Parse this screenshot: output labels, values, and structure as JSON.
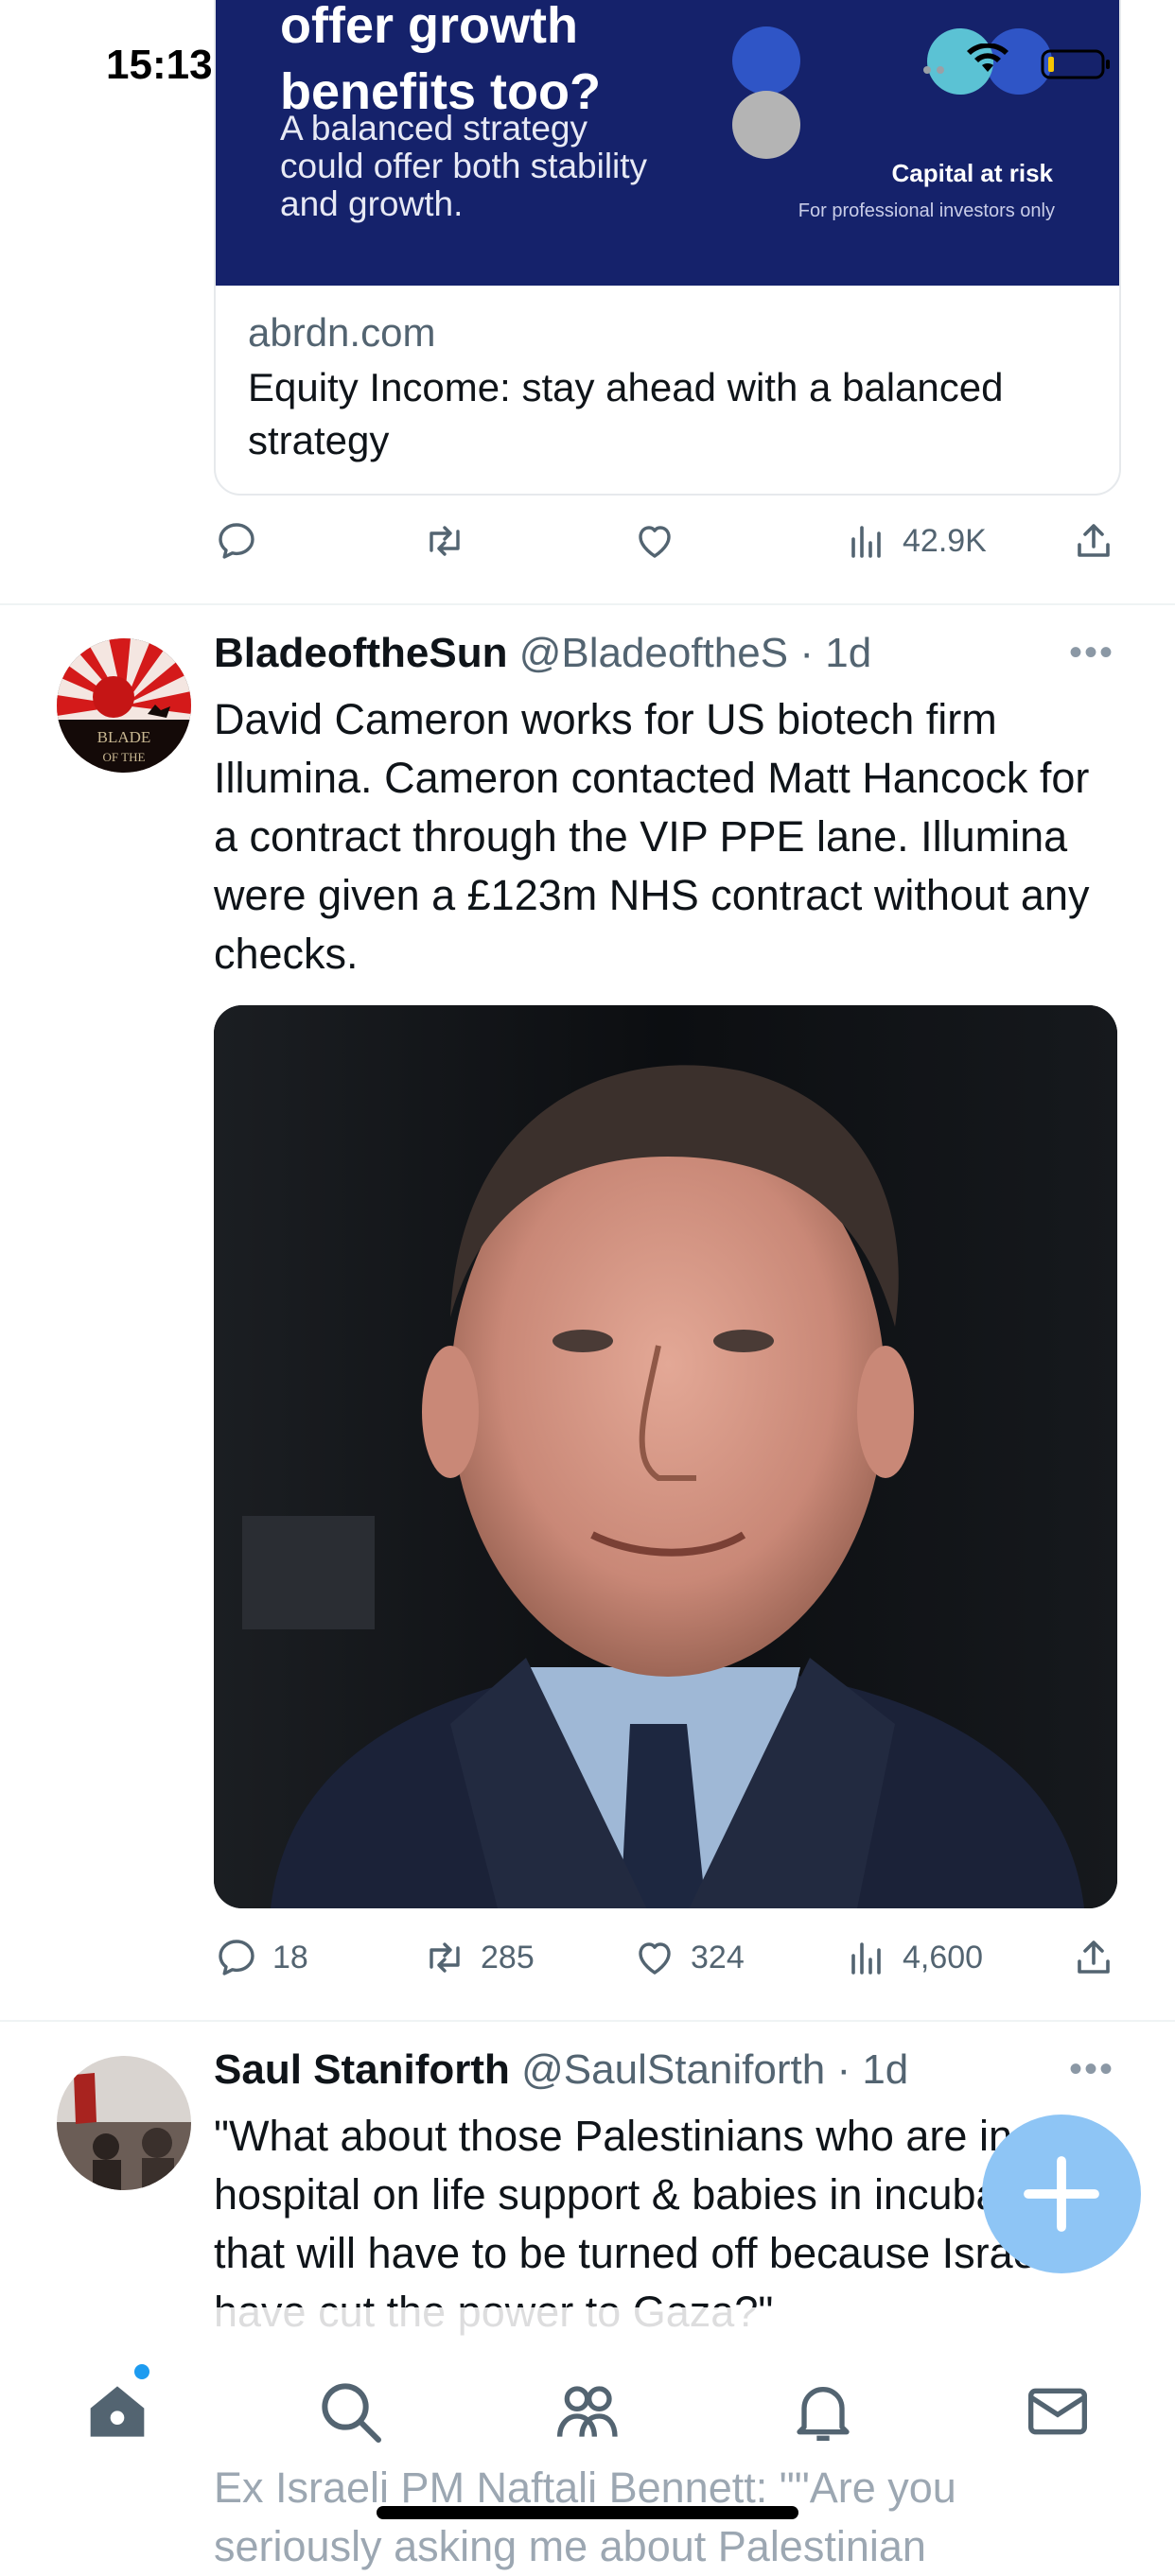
{
  "status_bar": {
    "time": "15:13"
  },
  "ad": {
    "headline_line1": "offer growth",
    "headline_line2": "benefits too?",
    "subtext": "A balanced strategy could offer both stability and growth.",
    "risk": "Capital at risk",
    "pro_only": "For professional investors only",
    "domain": "abrdn.com",
    "title": "Equity Income: stay ahead with a balanced strategy",
    "actions": {
      "views": "42.9K"
    },
    "colors": {
      "banner": "#15226b",
      "dot_blue": "#2f55c6",
      "dot_teal": "#5bc2d4",
      "dot_grey": "#b4b4b4"
    }
  },
  "tweet1": {
    "name": "BladeoftheSun",
    "handle": "@BladeoftheS",
    "time": "· 1d",
    "text": "David Cameron works for US biotech firm Illumina.  Cameron contacted Matt Hancock for a contract through the VIP PPE lane. Illumina were given a £123m NHS contract without any checks.",
    "avatar_text": "BLADE OF THE",
    "replies": "18",
    "retweets": "285",
    "likes": "324",
    "views": "4,600"
  },
  "tweet2": {
    "name": "Saul Staniforth",
    "handle": "@SaulStaniforth",
    "time": "· 1d",
    "text": "\"What about those Palestinians who are in hospital on life support & babies in incubators that will have to be turned off because Israelis have cut the power to Gaza?\"",
    "text2": "Ex Israeli PM Naftali Bennett: \"\"Are you seriously asking me about Palestinian"
  },
  "icons": {
    "reply": "reply-icon",
    "retweet": "retweet-icon",
    "like": "heart-icon",
    "views": "views-icon",
    "share": "share-icon",
    "more": "more-icon",
    "compose": "compose-plus-icon",
    "home": "home-icon",
    "search": "search-icon",
    "communities": "communities-icon",
    "notifications": "bell-icon",
    "messages": "mail-icon"
  },
  "colors": {
    "accent": "#1d9bf0",
    "fab": "#8ec5f5",
    "muted": "#536471"
  }
}
